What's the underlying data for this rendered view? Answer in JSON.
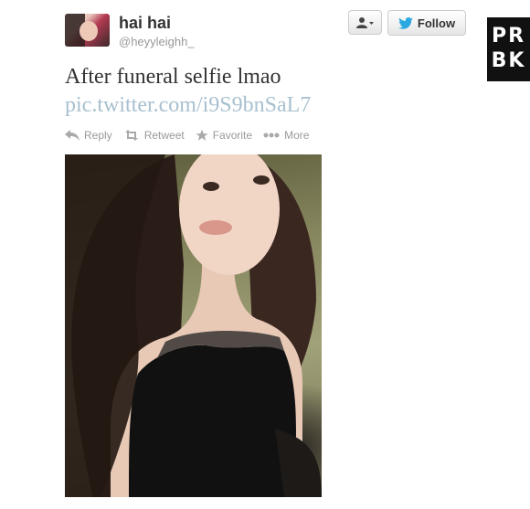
{
  "user": {
    "full_name": "hai hai",
    "username": "@heyyleighh_"
  },
  "follow_button": {
    "label": "Follow"
  },
  "watermark": {
    "line1": "PR",
    "line2": "BK"
  },
  "tweet": {
    "text": "After funeral selfie lmao",
    "link": "pic.twitter.com/i9S9bnSaL7"
  },
  "actions": {
    "reply": "Reply",
    "retweet": "Retweet",
    "favorite": "Favorite",
    "more": "More"
  },
  "colors": {
    "twitter_blue": "#2aa9e0",
    "link_color": "#a8c0cf",
    "action_gray": "#999999"
  }
}
